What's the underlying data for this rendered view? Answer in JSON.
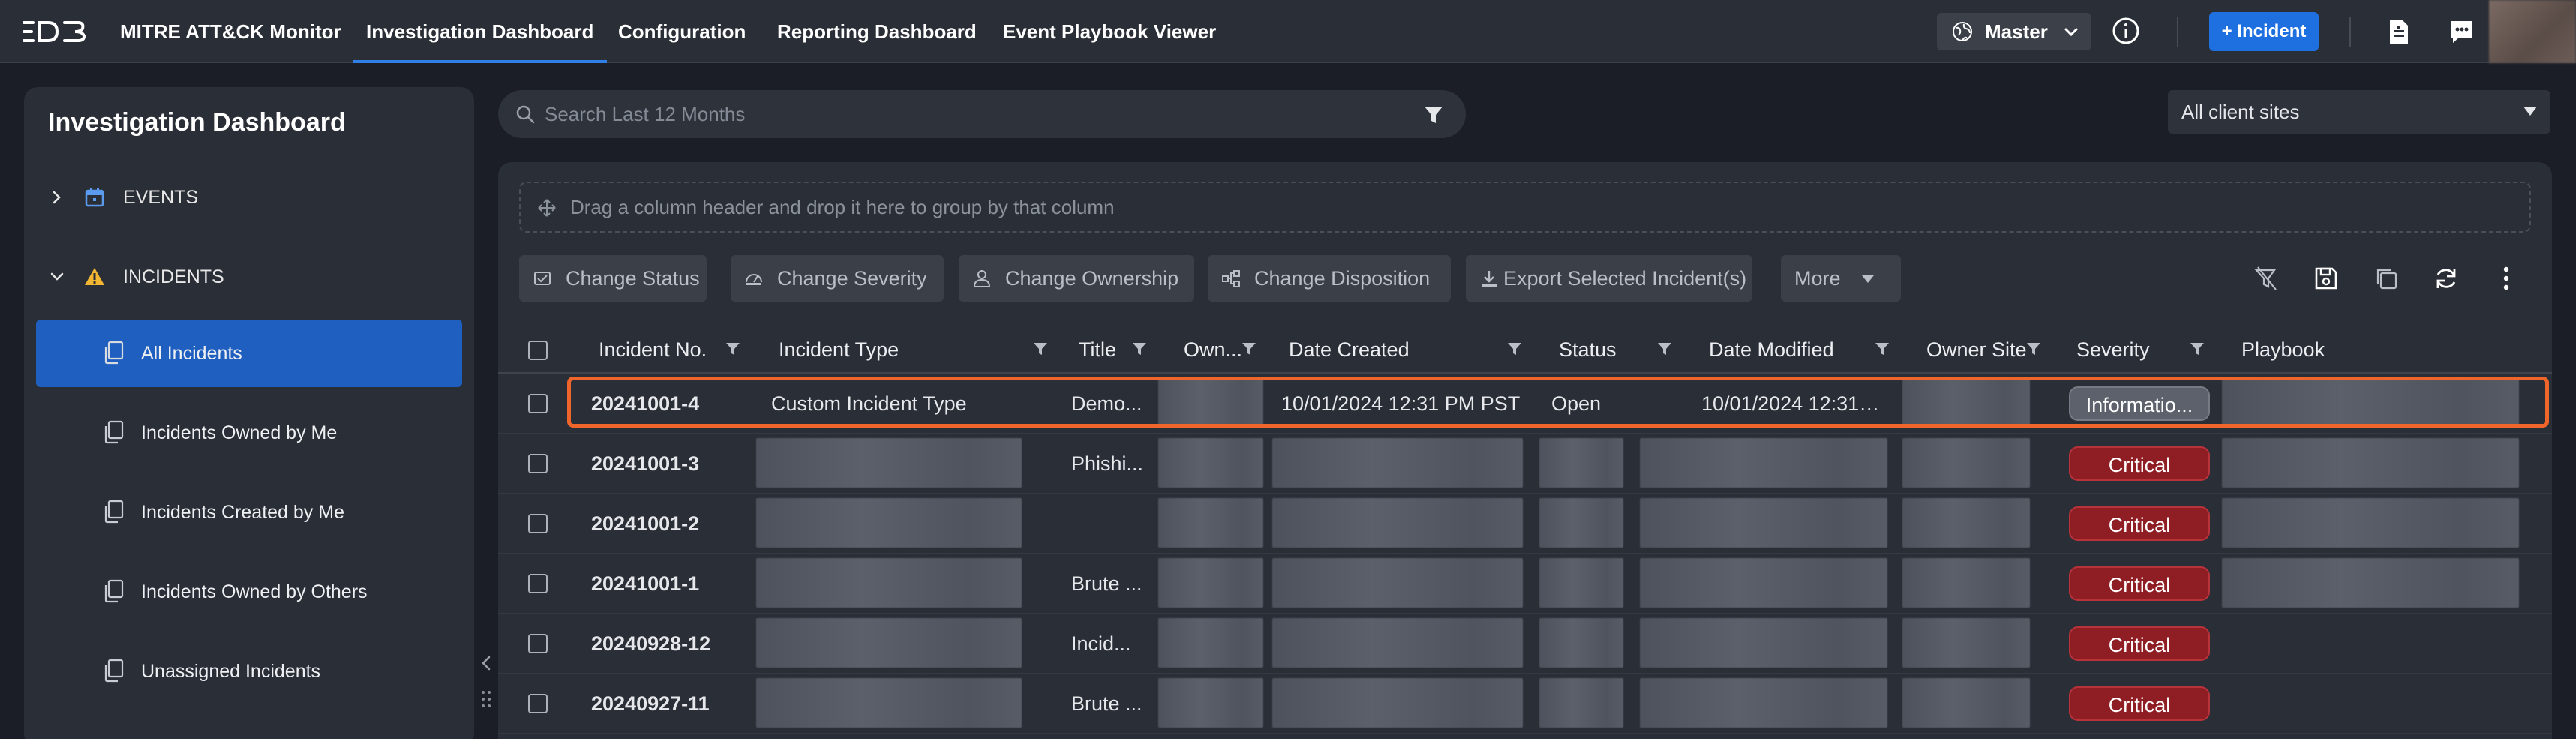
{
  "topnav": {
    "brand": "D3",
    "items": [
      {
        "label": "MITRE ATT&CK Monitor",
        "active": false
      },
      {
        "label": "Investigation Dashboard",
        "active": true
      },
      {
        "label": "Configuration",
        "active": false
      },
      {
        "label": "Reporting Dashboard",
        "active": false
      },
      {
        "label": "Event Playbook Viewer",
        "active": false
      }
    ],
    "tenant_label": "Master",
    "incident_button": "+ Incident",
    "icons": [
      "globe-icon",
      "chevron-down-icon",
      "info-icon",
      "document-icon",
      "chat-icon",
      "avatar"
    ]
  },
  "sidebar": {
    "title": "Investigation Dashboard",
    "sections": [
      {
        "label": "EVENTS",
        "expanded": false,
        "icon": "calendar-icon"
      },
      {
        "label": "INCIDENTS",
        "expanded": true,
        "icon": "warning-icon"
      }
    ],
    "items": [
      {
        "label": "All Incidents",
        "active": true
      },
      {
        "label": "Incidents Owned by Me",
        "active": false
      },
      {
        "label": "Incidents Created by Me",
        "active": false
      },
      {
        "label": "Incidents Owned by Others",
        "active": false
      },
      {
        "label": "Unassigned Incidents",
        "active": false
      }
    ]
  },
  "search": {
    "placeholder": "Search Last 12 Months",
    "value": ""
  },
  "site_select": {
    "selected": "All client sites"
  },
  "grid": {
    "group_hint": "Drag a column header and drop it here to group by that column",
    "toolbar": {
      "change_status": "Change Status",
      "change_severity": "Change Severity",
      "change_ownership": "Change Ownership",
      "change_disposition": "Change Disposition",
      "export": "Export Selected Incident(s)",
      "more": "More"
    },
    "columns": {
      "incident_no": "Incident No.",
      "incident_type": "Incident Type",
      "title": "Title",
      "owner": "Own...",
      "date_created": "Date Created",
      "status": "Status",
      "date_modified": "Date Modified",
      "owner_site": "Owner Site",
      "severity": "Severity",
      "playbook": "Playbook"
    },
    "rows": [
      {
        "incident_no": "20241001-4",
        "incident_type": "Custom Incident Type",
        "title": "Demo...",
        "date_created": "10/01/2024 12:31 PM PST",
        "status": "Open",
        "date_modified": "10/01/2024 12:31 ...",
        "severity": "Informatio...",
        "severity_level": "info"
      },
      {
        "incident_no": "20241001-3",
        "incident_type": "",
        "title": "Phishi...",
        "date_created": "",
        "status": "",
        "date_modified": "",
        "severity": "Critical",
        "severity_level": "critical"
      },
      {
        "incident_no": "20241001-2",
        "incident_type": "",
        "title": "",
        "date_created": "",
        "status": "",
        "date_modified": "",
        "severity": "Critical",
        "severity_level": "critical"
      },
      {
        "incident_no": "20241001-1",
        "incident_type": "",
        "title": "Brute ...",
        "date_created": "",
        "status": "",
        "date_modified": "",
        "severity": "Critical",
        "severity_level": "critical"
      },
      {
        "incident_no": "20240928-12",
        "incident_type": "",
        "title": "Incid...",
        "date_created": "",
        "status": "",
        "date_modified": "",
        "severity": "Critical",
        "severity_level": "critical"
      },
      {
        "incident_no": "20240927-11",
        "incident_type": "",
        "title": "Brute ...",
        "date_created": "",
        "status": "",
        "date_modified": "",
        "severity": "Critical",
        "severity_level": "critical"
      }
    ]
  },
  "colors": {
    "accent": "#1e6fe0",
    "sidebar_active": "#1f5fbf",
    "critical": "#8f1d24",
    "highlight": "#f0652a"
  }
}
